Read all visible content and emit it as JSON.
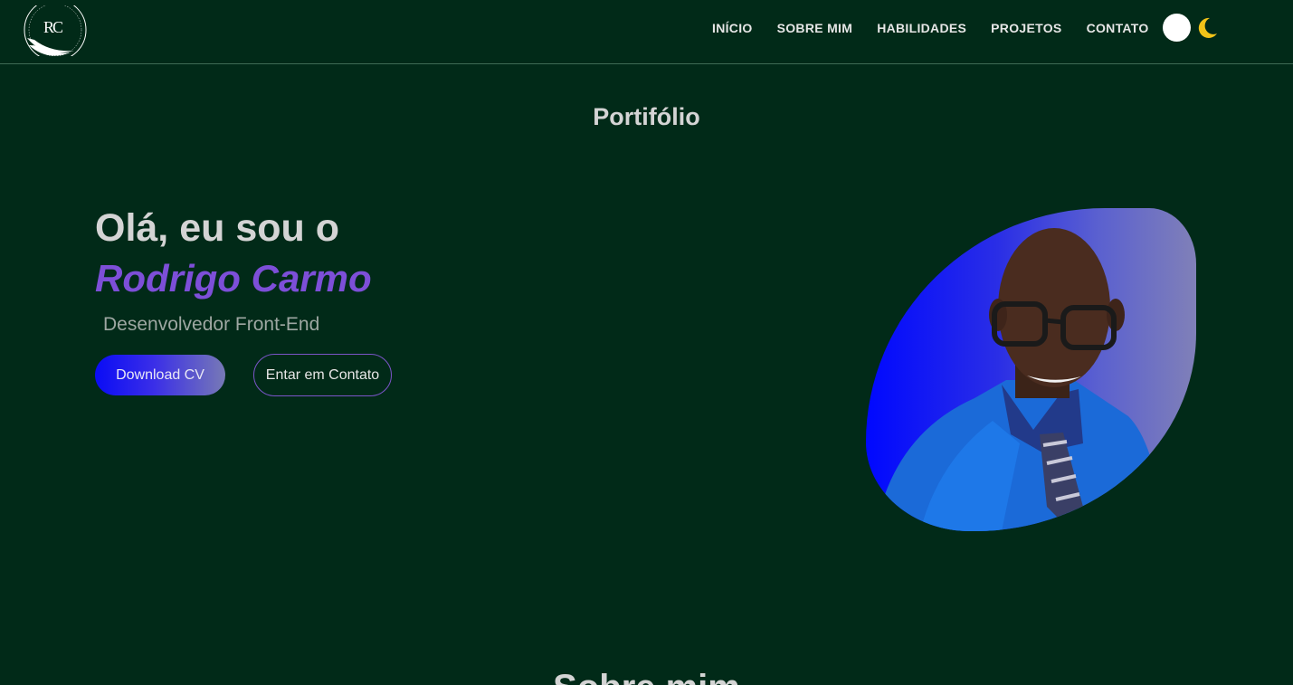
{
  "header": {
    "logo_monogram": "RC",
    "logo_ring_text": "DESENVOLVEDOR FRONT-END",
    "nav": [
      {
        "label": "INÍCIO"
      },
      {
        "label": "SOBRE MIM"
      },
      {
        "label": "HABILIDADES"
      },
      {
        "label": "PROJETOS"
      },
      {
        "label": "CONTATO"
      }
    ],
    "theme_toggle": {
      "light_icon": "sun-icon",
      "dark_icon": "moon-icon"
    }
  },
  "hero": {
    "section_title": "Portifólio",
    "greeting": "Olá, eu sou o",
    "name": "Rodrigo Carmo",
    "role": "Desenvolvedor Front-End",
    "download_button": "Download CV",
    "contact_button": "Entar em Contato"
  },
  "next_section": {
    "title": "Sobre mim"
  },
  "colors": {
    "background": "#012a18",
    "accent_purple": "#7d4fd8",
    "accent_blue": "#0a0cf5",
    "moon": "#f2c318"
  }
}
